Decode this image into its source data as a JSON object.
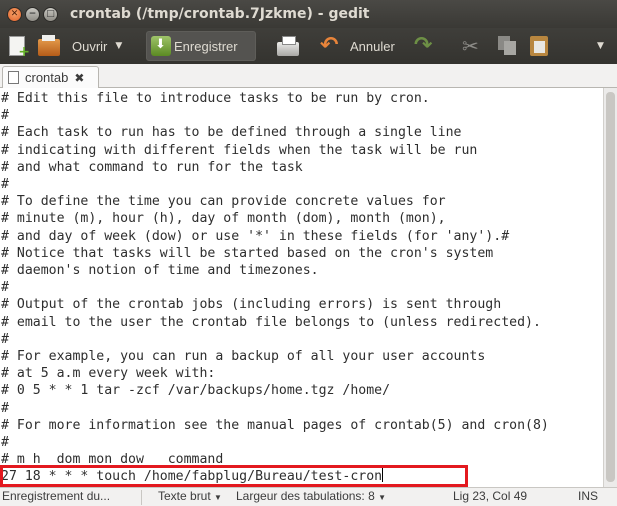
{
  "window": {
    "title": "crontab (/tmp/crontab.7Jzkme) - gedit"
  },
  "toolbar": {
    "open_label": "Ouvrir",
    "save_label": "Enregistrer",
    "undo_label": "Annuler"
  },
  "tab": {
    "label": "crontab"
  },
  "editor": {
    "lines": [
      "# Edit this file to introduce tasks to be run by cron.",
      "#",
      "# Each task to run has to be defined through a single line",
      "# indicating with different fields when the task will be run",
      "# and what command to run for the task",
      "#",
      "# To define the time you can provide concrete values for",
      "# minute (m), hour (h), day of month (dom), month (mon),",
      "# and day of week (dow) or use '*' in these fields (for 'any').#",
      "# Notice that tasks will be started based on the cron's system",
      "# daemon's notion of time and timezones.",
      "#",
      "# Output of the crontab jobs (including errors) is sent through",
      "# email to the user the crontab file belongs to (unless redirected).",
      "#",
      "# For example, you can run a backup of all your user accounts",
      "# at 5 a.m every week with:",
      "# 0 5 * * 1 tar -zcf /var/backups/home.tgz /home/",
      "#",
      "# For more information see the manual pages of crontab(5) and cron(8)",
      "#",
      "# m h  dom mon dow   command",
      "27 18 * * * touch /home/fabplug/Bureau/test-cron"
    ]
  },
  "statusbar": {
    "status": "Enregistrement du...",
    "syntax": "Texte brut",
    "tab_width": "Largeur des tabulations:  8",
    "position": "Lig 23, Col 49",
    "mode": "INS"
  }
}
